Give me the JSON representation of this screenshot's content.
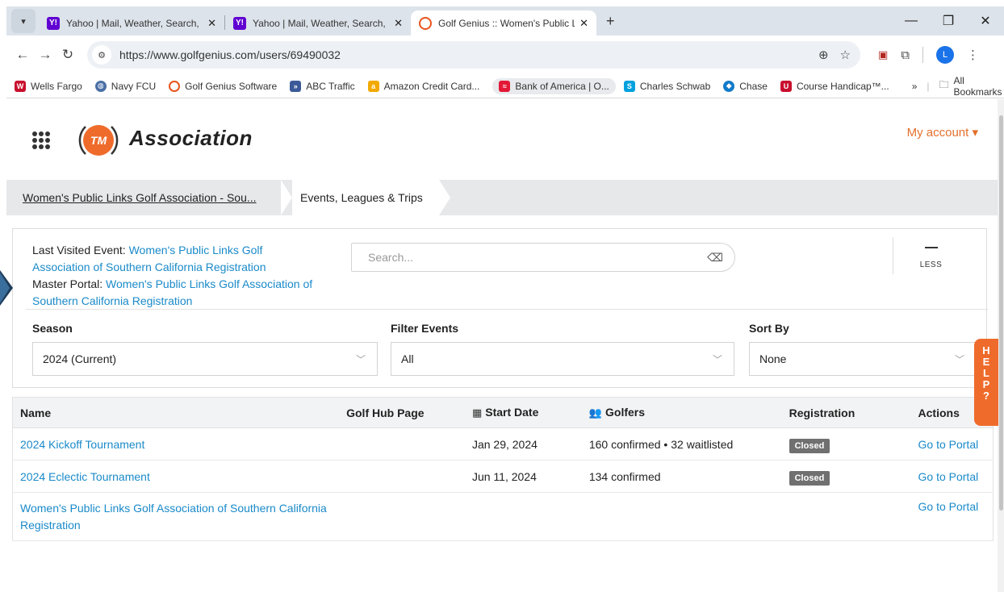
{
  "browser": {
    "tabs": [
      {
        "title": "Yahoo | Mail, Weather, Search, P",
        "icon": "yahoo-icon"
      },
      {
        "title": "Yahoo | Mail, Weather, Search, P",
        "icon": "yahoo-icon"
      },
      {
        "title": "Golf Genius :: Women's Public L",
        "icon": "golf-genius-icon"
      }
    ],
    "url": "https://www.golfgenius.com/users/69490032",
    "profile_initial": "L",
    "bookmarks": [
      "Wells Fargo",
      "Navy FCU",
      "Golf Genius Software",
      "ABC Traffic",
      "Amazon Credit Card...",
      "Bank of America | O...",
      "Charles Schwab",
      "Chase",
      "Course Handicap™..."
    ],
    "all_bookmarks": "All Bookmarks",
    "overflow": "»"
  },
  "header": {
    "logo_badge": "TM",
    "logo_text": "Association",
    "my_account": "My account ▾"
  },
  "breadcrumb": {
    "crumb1": "Women's Public Links Golf Association - Sou...",
    "crumb2": "Events, Leagues & Trips"
  },
  "filters": {
    "last_visited_label": "Last Visited Event:",
    "last_visited_link": "Women's Public Links Golf Association of Southern California Registration",
    "master_portal_label": "Master Portal:",
    "master_portal_link": "Women's Public Links Golf Association of Southern California Registration",
    "search_placeholder": "Search...",
    "less_label": "LESS",
    "season_label": "Season",
    "season_value": "2024 (Current)",
    "filter_label": "Filter Events",
    "filter_value": "All",
    "sort_label": "Sort By",
    "sort_value": "None"
  },
  "help": [
    "H",
    "E",
    "L",
    "P",
    "?"
  ],
  "table": {
    "headers": {
      "name": "Name",
      "hub": "Golf Hub Page",
      "date": "Start Date",
      "golfers": "Golfers",
      "registration": "Registration",
      "actions": "Actions"
    },
    "rows": [
      {
        "name": "2024 Kickoff Tournament",
        "date": "Jan 29, 2024",
        "golfers": "160 confirmed • 32 waitlisted",
        "registration": "Closed",
        "action": "Go to Portal"
      },
      {
        "name": "2024 Eclectic Tournament",
        "date": "Jun 11, 2024",
        "golfers": "134 confirmed",
        "registration": "Closed",
        "action": "Go to Portal"
      },
      {
        "name": "Women's Public Links Golf Association of Southern California Registration",
        "date": "",
        "golfers": "",
        "registration": "",
        "action": "Go to Portal"
      }
    ]
  }
}
